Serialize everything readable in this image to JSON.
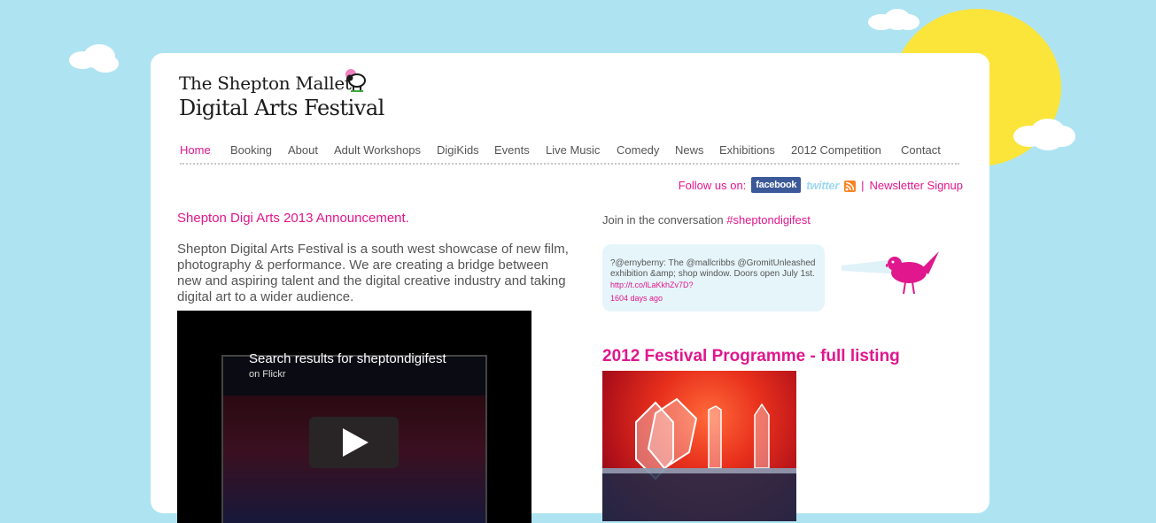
{
  "logo": {
    "line1": "The Shepton Mallet",
    "line2": "Digital Arts Festival"
  },
  "nav": [
    {
      "label": "Home",
      "active": true
    },
    {
      "label": "Booking"
    },
    {
      "label": "About"
    },
    {
      "label": "Adult Workshops"
    },
    {
      "label": "DigiKids"
    },
    {
      "label": "Events"
    },
    {
      "label": "Live Music"
    },
    {
      "label": "Comedy"
    },
    {
      "label": "News"
    },
    {
      "label": "Exhibitions"
    },
    {
      "label": "2012 Competition"
    },
    {
      "label": "Contact"
    }
  ],
  "follow": {
    "label": "Follow us on:",
    "facebook": "facebook",
    "twitter": "twitter",
    "rss_icon": "rss-icon",
    "separator": "|",
    "newsletter": "Newsletter Signup"
  },
  "announcement": {
    "title": "Shepton Digi Arts 2013 Announcement.",
    "body": "Shepton Digital Arts Festival is a south west showcase of new film, photography & performance.  We are creating a bridge between new and aspiring talent and the digital creative industry and taking digital art to a wider audience."
  },
  "video": {
    "title": "Search results for sheptondigifest",
    "subtitle": "on Flickr",
    "play_icon": "play-icon"
  },
  "twitter": {
    "join_text": "Join in the conversation",
    "hashtag": "#sheptondigifest",
    "tweet_text": "?@ernyberny: The @mallcribbs @GromitUnleashed exhibition &amp; shop window. Doors open July 1st.",
    "tweet_link": "http://t.co/lLaKkhZv7D?",
    "time_ago": "1604 days ago",
    "bird_icon": "bird-icon"
  },
  "programme": {
    "title": "2012 Festival Programme - full listing"
  },
  "colors": {
    "accent": "#e0178d",
    "sky": "#aee4f2",
    "sun": "#fbe53a"
  }
}
